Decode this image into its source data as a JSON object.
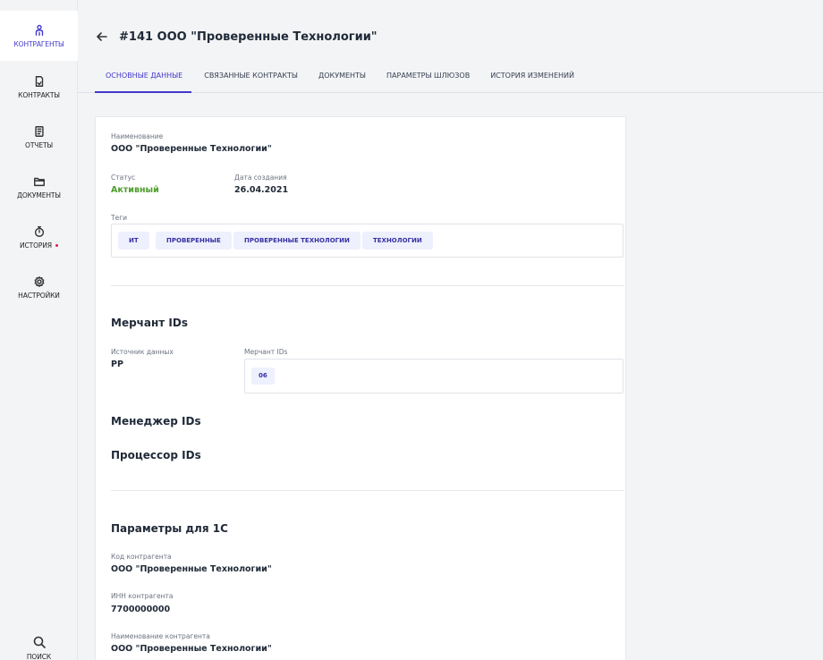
{
  "sidebar": {
    "items": [
      {
        "label": "КОНТРАГЕНТЫ",
        "icon": "users-icon"
      },
      {
        "label": "КОНТРАКТЫ",
        "icon": "contract-doc-icon"
      },
      {
        "label": "ОТЧЕТЫ",
        "icon": "report-icon"
      },
      {
        "label": "ДОКУМЕНТЫ",
        "icon": "folder-icon"
      },
      {
        "label": "ИСТОРИЯ",
        "icon": "stopwatch-icon"
      },
      {
        "label": "НАСТРОЙКИ",
        "icon": "gear-icon"
      },
      {
        "label": "ПОИСК",
        "icon": "search-icon"
      }
    ]
  },
  "header": {
    "title": "#141 ООО \"Проверенные Технологии\""
  },
  "tabs": [
    "ОСНОВНЫЕ ДАННЫЕ",
    "СВЯЗАННЫЕ КОНТРАКТЫ",
    "ДОКУМЕНТЫ",
    "ПАРАМЕТРЫ ШЛЮЗОВ",
    "ИСТОРИЯ ИЗМЕНЕНИЙ"
  ],
  "main": {
    "name_label": "Наименование",
    "name_value": "ООО \"Проверенные Технологии\"",
    "status_label": "Статус",
    "status_value": "Активный",
    "created_label": "Дата создания",
    "created_value": "26.04.2021",
    "tags_label": "Теги",
    "tags": [
      "ИТ",
      "ПРОВЕРЕННЫЕ",
      "ПРОВЕРЕННЫЕ ТЕХНОЛОГИИ",
      "ТЕХНОЛОГИИ"
    ]
  },
  "merchant": {
    "section_title": "Мерчант IDs",
    "source_label": "Источник данных",
    "source_value": "PP",
    "ids_label": "Мерчант IDs",
    "ids": [
      "06"
    ]
  },
  "manager": {
    "section_title": "Менеджер IDs"
  },
  "processor": {
    "section_title": "Процессор IDs"
  },
  "params1c": {
    "section_title": "Параметры для 1С",
    "code_label": "Код контрагента",
    "code_value": "ООО \"Проверенные Технологии\"",
    "inn_label": "ИНН контрагента",
    "inn_value": "7700000000",
    "name_label": "Наименование контрагента",
    "name_value": "ООО \"Проверенные Технологии\""
  },
  "colors": {
    "accent": "#4338ca",
    "status_active": "#4d9d2a",
    "chip_bg": "#eef0fd",
    "history_dot": "#e11d48"
  }
}
